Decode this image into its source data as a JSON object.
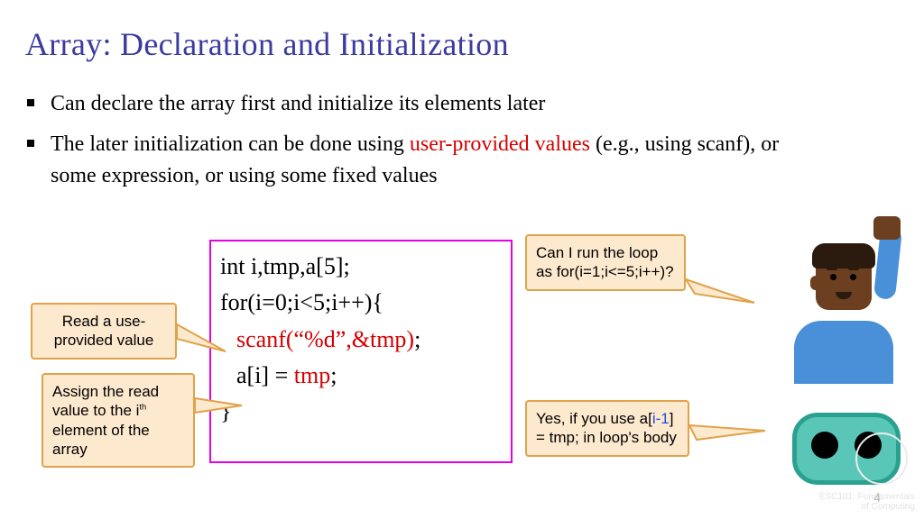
{
  "title": "Array: Declaration and Initialization",
  "bullets": {
    "b1": "Can declare the array first and initialize its elements later",
    "b2_pre": "The later initialization can be done using ",
    "b2_hl": "user-provided values",
    "b2_post": " (e.g., using scanf), or some expression, or using some fixed values"
  },
  "code": {
    "l1": "int i,tmp,a[5];",
    "l2": "for(i=0;i<5;i++){",
    "l3a": "scanf(“%d”,&tmp)",
    "l3b": ";",
    "l4a": "a[i] = ",
    "l4b": "tmp",
    "l4c": ";",
    "l5": "}"
  },
  "callouts": {
    "c1": "Read a use-\nprovided value",
    "c2_a": "Assign the read value to the i",
    "c2_b": "th",
    "c2_c": " element of the array",
    "c3_a": "Can I run the loop as ",
    "c3_b": "for(i=1;i<=5;i++)?",
    "c4_a": "Yes, if you use a[",
    "c4_b": "i-1",
    "c4_c": "] = tmp; in loop's body"
  },
  "page_number": "4",
  "watermark": "ESC101: Fundamentals\nof Computing"
}
